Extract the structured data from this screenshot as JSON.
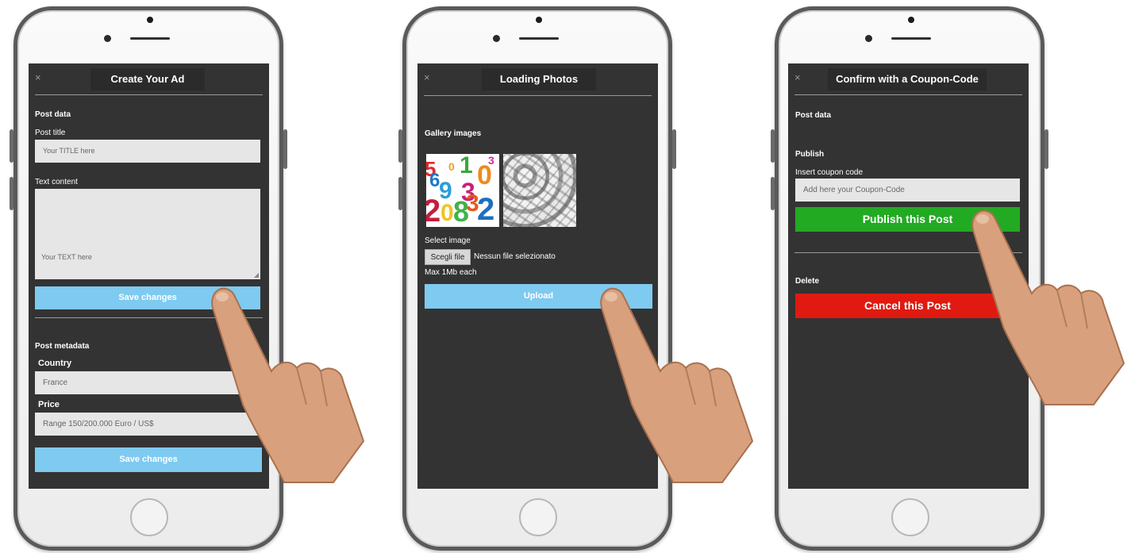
{
  "close_symbol": "×",
  "screen1": {
    "title": "Create Your Ad",
    "section_post_data": "Post data",
    "post_title_label": "Post title",
    "post_title_placeholder": "Your TITLE here",
    "text_content_label": "Text content",
    "text_content_placeholder": "Your TEXT here",
    "save_button": "Save changes",
    "section_metadata": "Post metadata",
    "country_label": "Country",
    "country_value": "France",
    "price_label": "Price",
    "price_value": "Range 150/200.000 Euro / US$",
    "save_button_2": "Save changes"
  },
  "screen2": {
    "title": "Loading Photos",
    "gallery_label": "Gallery images",
    "tile_digits": [
      "5",
      "6",
      "0",
      "1",
      "0",
      "3",
      "9",
      "3",
      "2",
      "0",
      "8",
      "3",
      "2"
    ],
    "select_label": "Select image",
    "choose_file_button": "Scegli file",
    "no_file_text": "Nessun file selezionato",
    "max_note": "Max 1Mb each",
    "upload_button": "Upload"
  },
  "screen3": {
    "title": "Confirm with a Coupon-Code",
    "section_post_data": "Post data",
    "section_publish": "Publish",
    "coupon_label": "Insert coupon code",
    "coupon_placeholder": "Add here your Coupon-Code",
    "publish_button": "Publish this Post",
    "section_delete": "Delete",
    "cancel_button": "Cancel this Post"
  },
  "colors": {
    "screen_bg": "#333333",
    "field_bg": "#e6e6e6",
    "button_blue": "#7fcaf0",
    "button_green": "#22aa22",
    "button_red": "#e01a10"
  },
  "icons": [
    "close-icon",
    "pointing-hand-icon"
  ]
}
